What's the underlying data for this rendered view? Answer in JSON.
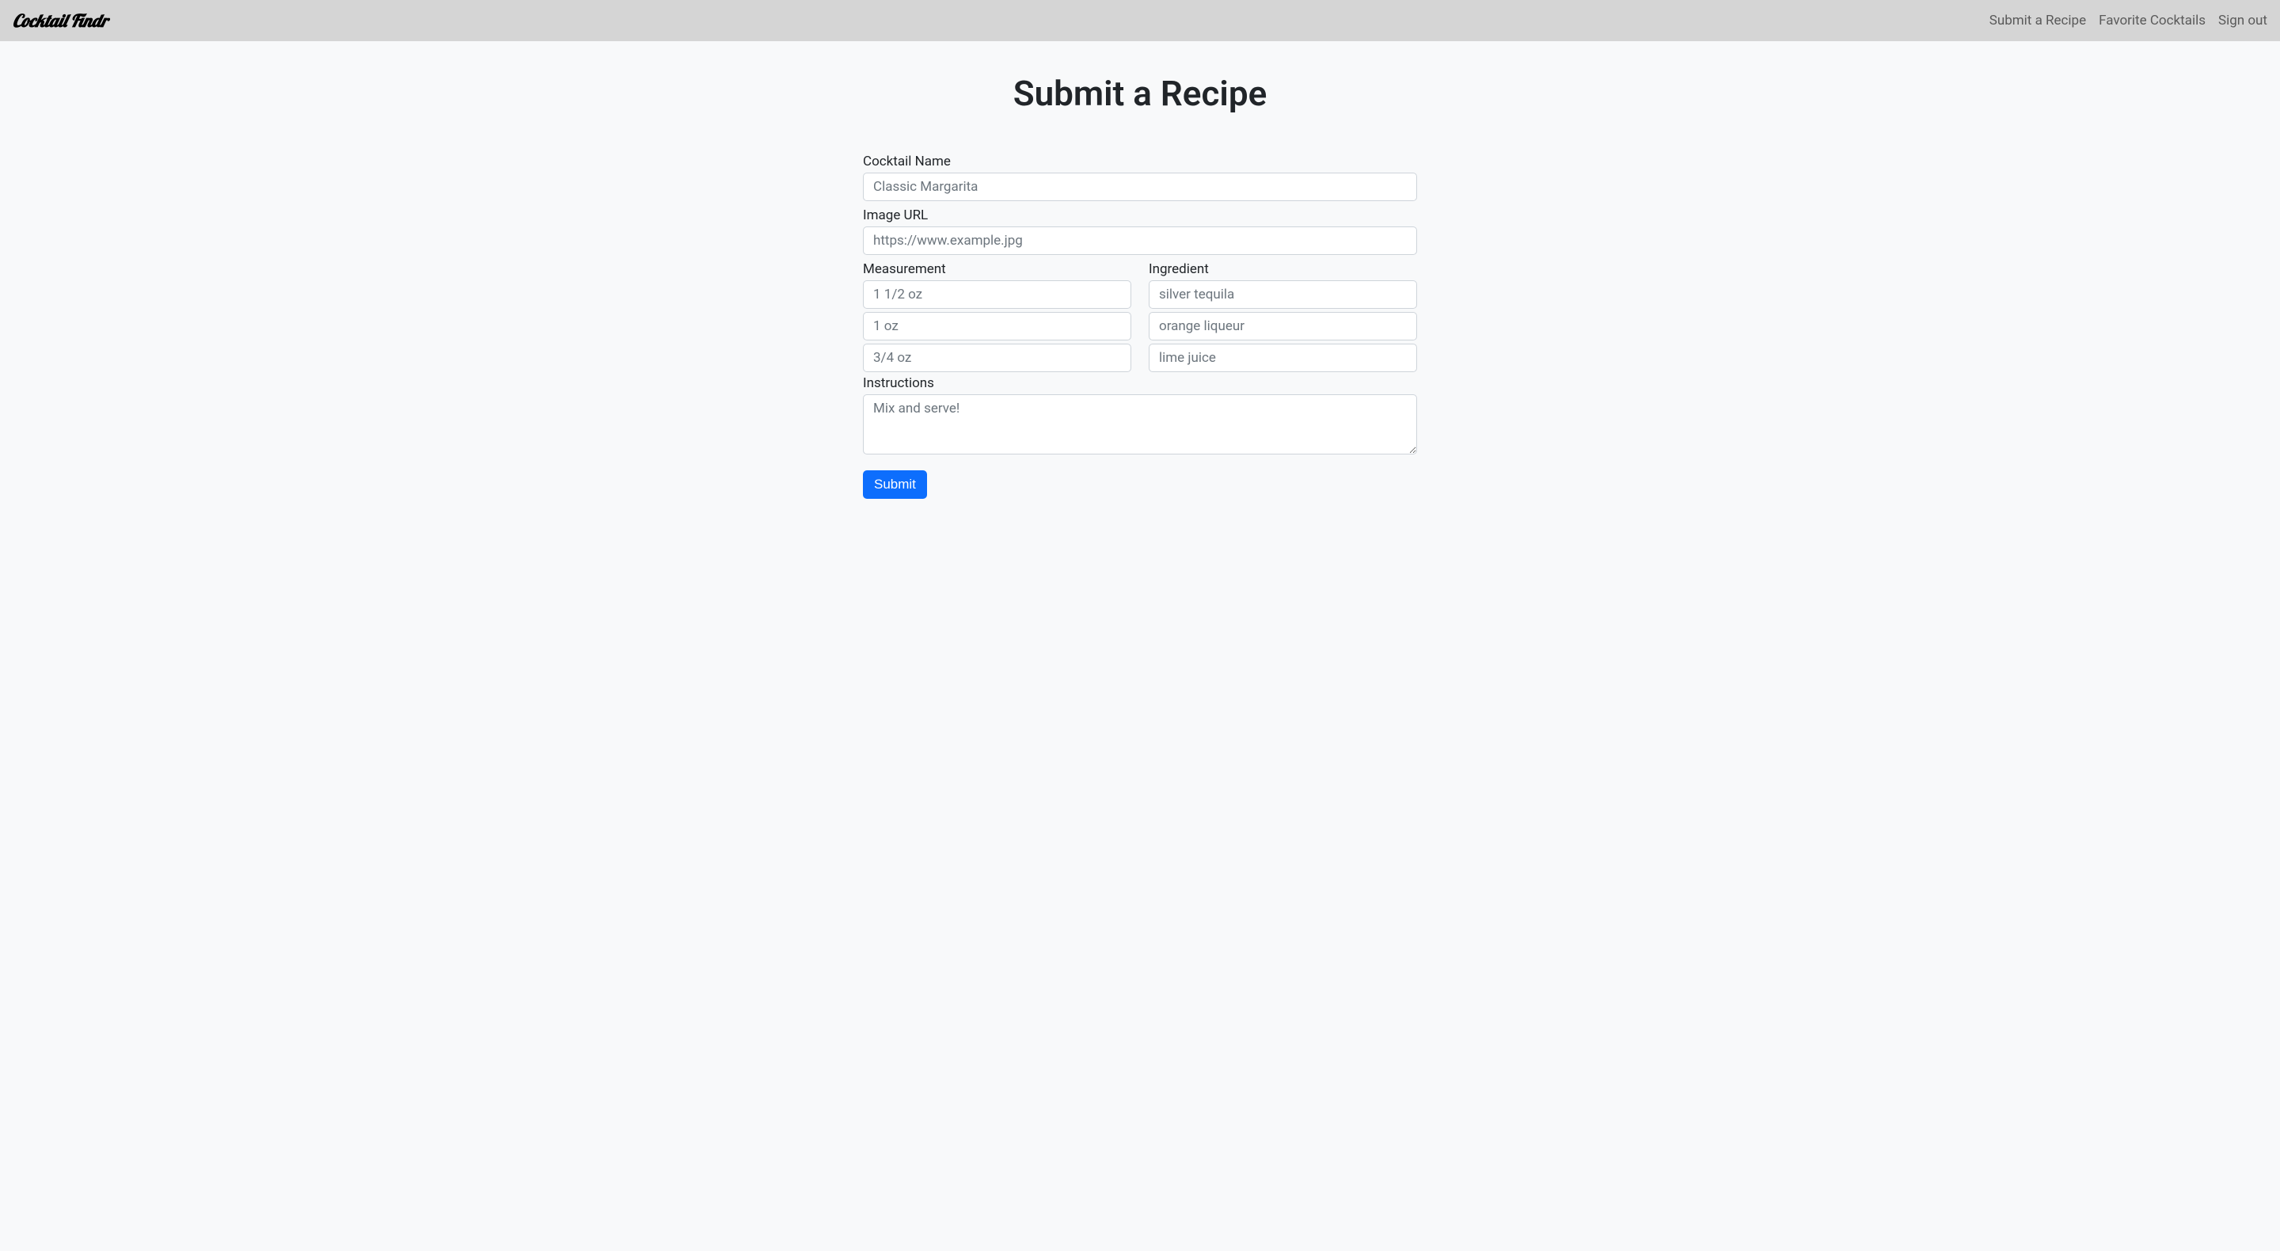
{
  "navbar": {
    "brand": "Cocktail Findr",
    "links": [
      {
        "label": "Submit a Recipe"
      },
      {
        "label": "Favorite Cocktails"
      },
      {
        "label": "Sign out"
      }
    ]
  },
  "page": {
    "title": "Submit a Recipe"
  },
  "form": {
    "cocktailName": {
      "label": "Cocktail Name",
      "placeholder": "Classic Margarita",
      "value": ""
    },
    "imageUrl": {
      "label": "Image URL",
      "placeholder": "https://www.example.jpg",
      "value": ""
    },
    "measurement": {
      "label": "Measurement",
      "rows": [
        {
          "placeholder": "1 1/2 oz",
          "value": ""
        },
        {
          "placeholder": "1 oz",
          "value": ""
        },
        {
          "placeholder": "3/4 oz",
          "value": ""
        }
      ]
    },
    "ingredient": {
      "label": "Ingredient",
      "rows": [
        {
          "placeholder": "silver tequila",
          "value": ""
        },
        {
          "placeholder": "orange liqueur",
          "value": ""
        },
        {
          "placeholder": "lime juice",
          "value": ""
        }
      ]
    },
    "instructions": {
      "label": "Instructions",
      "placeholder": "Mix and serve!",
      "value": ""
    },
    "submitButton": {
      "label": "Submit"
    }
  }
}
